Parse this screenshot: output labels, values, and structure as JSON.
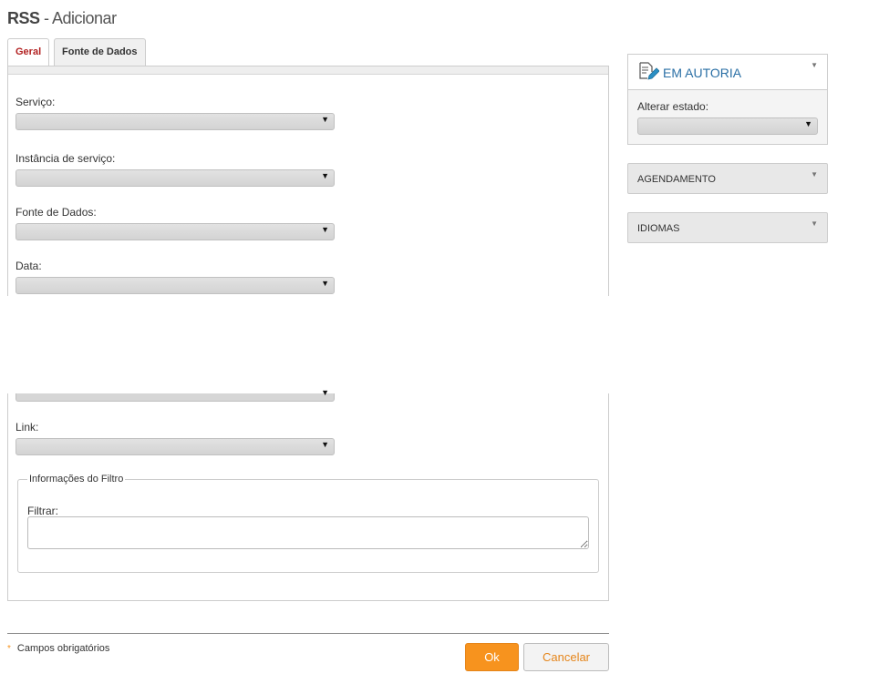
{
  "header": {
    "title_strong": "RSS",
    "title_rest": " - Adicionar"
  },
  "tabs": [
    {
      "label": "Geral"
    },
    {
      "label": "Fonte de Dados"
    }
  ],
  "form": {
    "fields": [
      {
        "label": "Serviço:"
      },
      {
        "label": "Instância de serviço:"
      },
      {
        "label": "Fonte de Dados:"
      },
      {
        "label": "Data:"
      },
      {
        "label": "Link:"
      }
    ],
    "filter": {
      "legend": "Informações do Filtro",
      "label": "Filtrar:",
      "value": ""
    }
  },
  "footer": {
    "required_marker": "*",
    "required_note": "Campos obrigatórios",
    "ok_label": "Ok",
    "cancel_label": "Cancelar"
  },
  "sidebar": {
    "status": {
      "title": "EM AUTORIA",
      "change_label": "Alterar estado:",
      "selected": ""
    },
    "schedule_title": "AGENDAMENTO",
    "languages_title": "IDIOMAS"
  },
  "icons": {
    "dropdown": "caret-down",
    "collapse": "triangle-down",
    "status": "document-edit-icon"
  },
  "colors": {
    "accent": "#f7931e",
    "active_tab": "#b22222",
    "status_title": "#2a6fa5"
  }
}
